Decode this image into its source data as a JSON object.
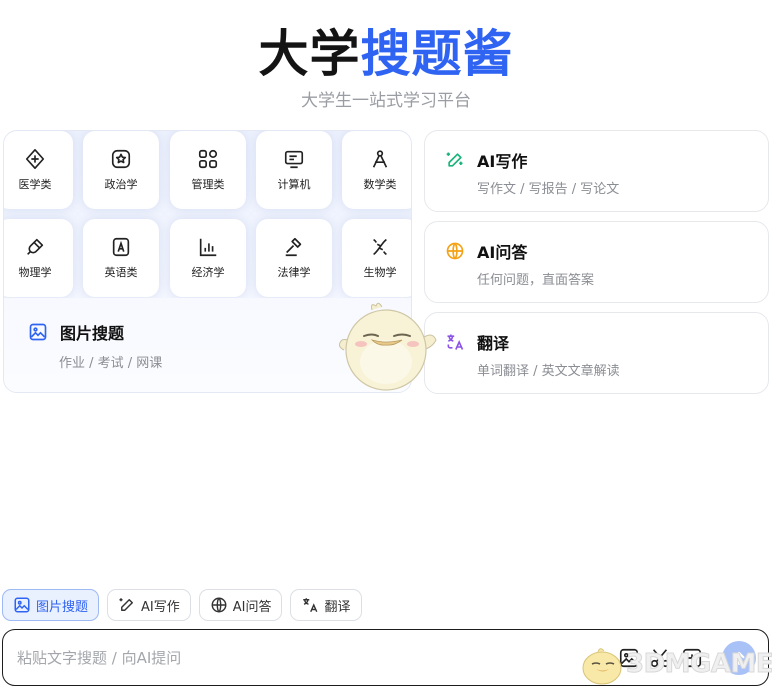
{
  "header": {
    "title_part1": "大学",
    "title_part2": "搜题酱",
    "subtitle": "大学生一站式学习平台"
  },
  "subjects": [
    {
      "label": "医学类",
      "icon": "medical-icon"
    },
    {
      "label": "政治学",
      "icon": "politics-badge-icon"
    },
    {
      "label": "管理类",
      "icon": "grid-icon"
    },
    {
      "label": "计算机",
      "icon": "computer-icon"
    },
    {
      "label": "数学类",
      "icon": "compass-icon"
    },
    {
      "label": "物理学",
      "icon": "magnet-icon"
    },
    {
      "label": "英语类",
      "icon": "letter-a-icon"
    },
    {
      "label": "经济学",
      "icon": "bar-chart-icon"
    },
    {
      "label": "法律学",
      "icon": "gavel-icon"
    },
    {
      "label": "生物学",
      "icon": "dna-icon"
    }
  ],
  "image_search": {
    "title": "图片搜题",
    "subtitle": "作业 / 考试 / 网课",
    "icon": "image-icon"
  },
  "feature_cards": [
    {
      "title": "AI写作",
      "subtitle": "写作文 / 写报告 / 写论文",
      "icon": "magic-pen-icon",
      "color": "#19b47a"
    },
    {
      "title": "AI问答",
      "subtitle": "任何问题，直面答案",
      "icon": "globe-icon",
      "color": "#f5a216"
    },
    {
      "title": "翻译",
      "subtitle": "单词翻译 / 英文文章解读",
      "icon": "translate-icon",
      "color": "#8b53e6"
    }
  ],
  "chips": [
    {
      "label": "图片搜题",
      "icon": "image-icon",
      "active": true
    },
    {
      "label": "AI写作",
      "icon": "magic-pen-icon",
      "active": false
    },
    {
      "label": "AI问答",
      "icon": "globe-icon",
      "active": false
    },
    {
      "label": "翻译",
      "icon": "translate-icon",
      "active": false
    }
  ],
  "input": {
    "placeholder": "粘贴文字搜题 / 向AI提问",
    "value": ""
  },
  "watermark": {
    "text": "3DMGAME"
  },
  "colors": {
    "brand_blue": "#2f63f2",
    "send_button": "#a8c1f6"
  }
}
